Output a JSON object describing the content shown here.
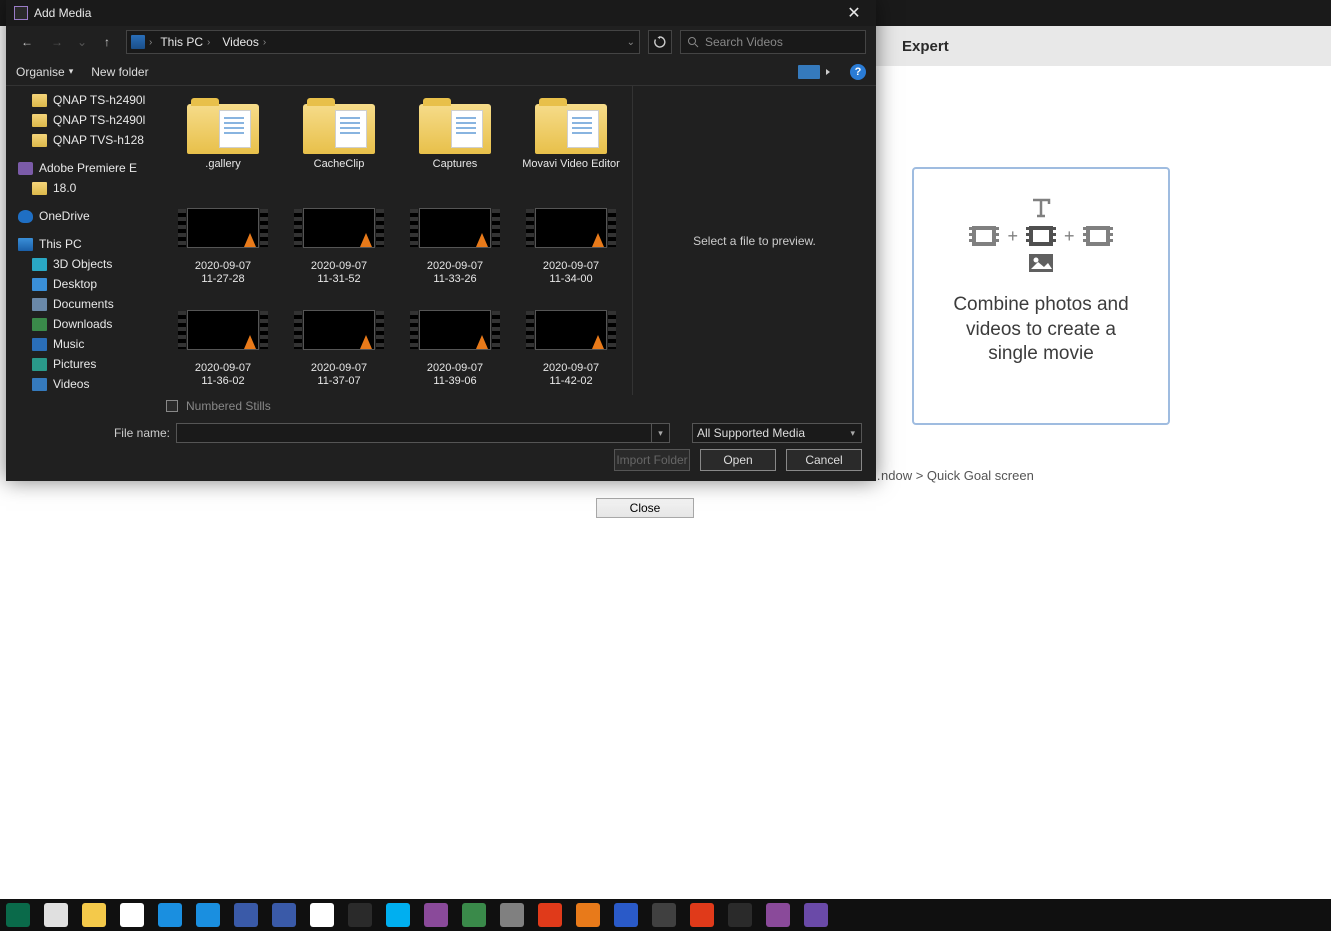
{
  "backdrop": {
    "tab_label": "Expert",
    "breadcrumb_partial": "…ndow > Quick Goal screen",
    "close_button": "Close"
  },
  "card": {
    "line1": "Combine photos and",
    "line2": "videos to create a",
    "line3": "single movie"
  },
  "dialog": {
    "title": "Add Media",
    "nav": {
      "path_segment_1": "This PC",
      "path_segment_2": "Videos",
      "search_placeholder": "Search Videos"
    },
    "toolbar": {
      "organise": "Organise",
      "new_folder": "New folder"
    },
    "sidebar": [
      {
        "label": "QNAP TS-h2490l",
        "icon": "si-folder",
        "lvl": 1
      },
      {
        "label": "QNAP TS-h2490l",
        "icon": "si-folder",
        "lvl": 1
      },
      {
        "label": "QNAP TVS-h128",
        "icon": "si-folder",
        "lvl": 1
      },
      {
        "label": "Adobe Premiere E",
        "icon": "si-prem",
        "lvl": 0,
        "sep": true
      },
      {
        "label": "18.0",
        "icon": "si-folder",
        "lvl": 1
      },
      {
        "label": "OneDrive",
        "icon": "si-cloud",
        "lvl": 0,
        "sep": true
      },
      {
        "label": "This PC",
        "icon": "si-pc",
        "lvl": 0,
        "sep": true
      },
      {
        "label": "3D Objects",
        "icon": "si-3d",
        "lvl": 1
      },
      {
        "label": "Desktop",
        "icon": "si-desk",
        "lvl": 1
      },
      {
        "label": "Documents",
        "icon": "si-doc",
        "lvl": 1
      },
      {
        "label": "Downloads",
        "icon": "si-dl",
        "lvl": 1
      },
      {
        "label": "Music",
        "icon": "si-music",
        "lvl": 1
      },
      {
        "label": "Pictures",
        "icon": "si-pic",
        "lvl": 1
      },
      {
        "label": "Videos",
        "icon": "si-vid",
        "lvl": 1
      }
    ],
    "folders": [
      {
        "label": ".gallery"
      },
      {
        "label": "CacheClip"
      },
      {
        "label": "Captures"
      },
      {
        "label": "Movavi Video Editor"
      }
    ],
    "videos": [
      {
        "l1": "2020-09-07",
        "l2": "11-27-28"
      },
      {
        "l1": "2020-09-07",
        "l2": "11-31-52"
      },
      {
        "l1": "2020-09-07",
        "l2": "11-33-26"
      },
      {
        "l1": "2020-09-07",
        "l2": "11-34-00"
      },
      {
        "l1": "2020-09-07",
        "l2": "11-36-02"
      },
      {
        "l1": "2020-09-07",
        "l2": "11-37-07"
      },
      {
        "l1": "2020-09-07",
        "l2": "11-39-06"
      },
      {
        "l1": "2020-09-07",
        "l2": "11-42-02"
      }
    ],
    "preview_text": "Select a file to preview.",
    "numbered_stills": "Numbered Stills",
    "footer": {
      "file_name_label": "File name:",
      "file_name_value": "",
      "filter": "All Supported Media",
      "import_folder": "Import Folder",
      "open": "Open",
      "cancel": "Cancel"
    }
  },
  "taskbar_icons": [
    "start",
    "task-view",
    "file-explorer",
    "chrome",
    "cortana-1",
    "cortana-2",
    "samsung",
    "calculator",
    "notepad",
    "obs",
    "skype",
    "premiere",
    "solitaire",
    "settings",
    "yandex",
    "firefox",
    "word",
    "app-1",
    "anydesk",
    "app-2",
    "app-3",
    "app-4"
  ],
  "colors": {
    "dialog_bg": "#202020",
    "accent": "#357abd",
    "card_border": "#9fbce0"
  }
}
